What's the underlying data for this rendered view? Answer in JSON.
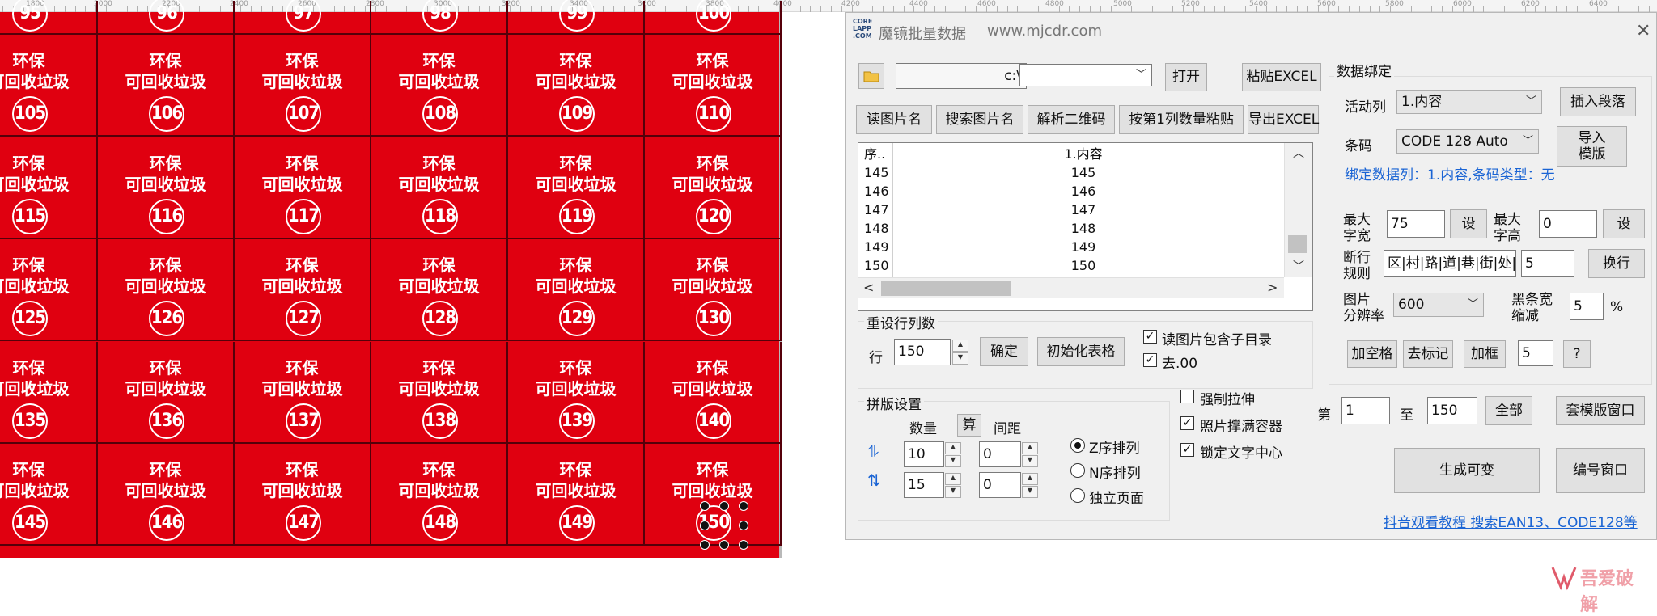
{
  "ruler": {
    "labels": [
      "1800",
      "2000",
      "2200",
      "2400",
      "2600",
      "2800",
      "3000",
      "3200",
      "3400",
      "3600",
      "3800",
      "4000",
      "4200",
      "4400",
      "4600",
      "4800",
      "5000",
      "5200",
      "5400",
      "5600",
      "5800",
      "6000",
      "6200",
      "6400"
    ]
  },
  "canvas": {
    "line1": "环保",
    "line2": "可回收垃圾",
    "top_numbers": [
      "95",
      "96",
      "97",
      "98",
      "99",
      "100"
    ],
    "rows": [
      [
        "105",
        "106",
        "107",
        "108",
        "109",
        "110"
      ],
      [
        "115",
        "116",
        "117",
        "118",
        "119",
        "120"
      ],
      [
        "125",
        "126",
        "127",
        "128",
        "129",
        "130"
      ],
      [
        "135",
        "136",
        "137",
        "138",
        "139",
        "140"
      ],
      [
        "145",
        "146",
        "147",
        "148",
        "149",
        "150"
      ]
    ]
  },
  "dialog": {
    "logo": "CORE LAPP .COM",
    "title": "魔镜批量数据",
    "url": "www.mjcdr.com",
    "close": "✕",
    "path_value": "c:\\",
    "open_btn": "打开",
    "paste_excel_btn": "粘贴EXCEL",
    "tabs": [
      "读图片名",
      "搜索图片名",
      "解析二维码",
      "按第1列数量粘贴",
      "导出EXCEL"
    ],
    "grid": {
      "header": [
        "序..",
        "1.内容"
      ],
      "rows": [
        [
          "145",
          "145"
        ],
        [
          "146",
          "146"
        ],
        [
          "147",
          "147"
        ],
        [
          "148",
          "148"
        ],
        [
          "149",
          "149"
        ],
        [
          "150",
          "150"
        ]
      ]
    },
    "reset_rows": {
      "legend": "重设行列数",
      "row_label": "行",
      "row_value": "150",
      "confirm_btn": "确定",
      "init_btn": "初始化表格",
      "chk_subdir": "读图片包含子目录",
      "chk_dot00": "去.00"
    },
    "layout": {
      "legend": "拼版设置",
      "count_label": "数量",
      "calc_btn": "算",
      "spacing_label": "间距",
      "h_count": "10",
      "h_gap": "0",
      "v_count": "15",
      "v_gap": "0",
      "radio_z": "Z序排列",
      "radio_n": "N序排列",
      "radio_page": "独立页面"
    },
    "options": {
      "force_stretch": "强制拉伸",
      "fill_container": "照片撑满容器",
      "lock_text_center": "锁定文字中心"
    },
    "binding": {
      "legend": "数据绑定",
      "active_col_label": "活动列",
      "active_col_value": "1.内容",
      "insert_para_btn": "插入段落",
      "barcode_label": "条码",
      "barcode_value": "CODE 128 Auto",
      "import_template_btn": "导入\n模版",
      "bind_info": "绑定数据列：1.内容,条码类型：无",
      "max_width_label": "最大\n字宽",
      "max_width_value": "75",
      "set_btn": "设",
      "max_height_label": "最大\n字高",
      "max_height_value": "0",
      "break_rule_label": "断行\n规则",
      "break_rule_value": "区|村|路|道|巷|街|处|",
      "break_num": "5",
      "wrap_btn": "换行",
      "resolution_label": "图片\n分辨率",
      "resolution_value": "600",
      "bar_shrink_label": "黑条宽\n缩减",
      "bar_shrink_value": "5",
      "percent": "%",
      "add_space_btn": "加空格",
      "remove_mark_btn": "去标记",
      "add_border_btn": "加框",
      "extra_value": "5",
      "help_btn": "?"
    },
    "range": {
      "from_label": "第",
      "from_value": "1",
      "to_label": "至",
      "to_value": "150",
      "all_btn": "全部",
      "template_window_btn": "套模版窗口"
    },
    "generate_btn": "生成可变",
    "number_window_btn": "编号窗口",
    "footer_link": "抖音观看教程 搜索EAN13、CODE128等"
  },
  "watermark": "吾爱破解",
  "colors": {
    "card_red": "#e00010",
    "link_blue": "#1a64d4",
    "dialog_bg": "#f0f0f0"
  }
}
